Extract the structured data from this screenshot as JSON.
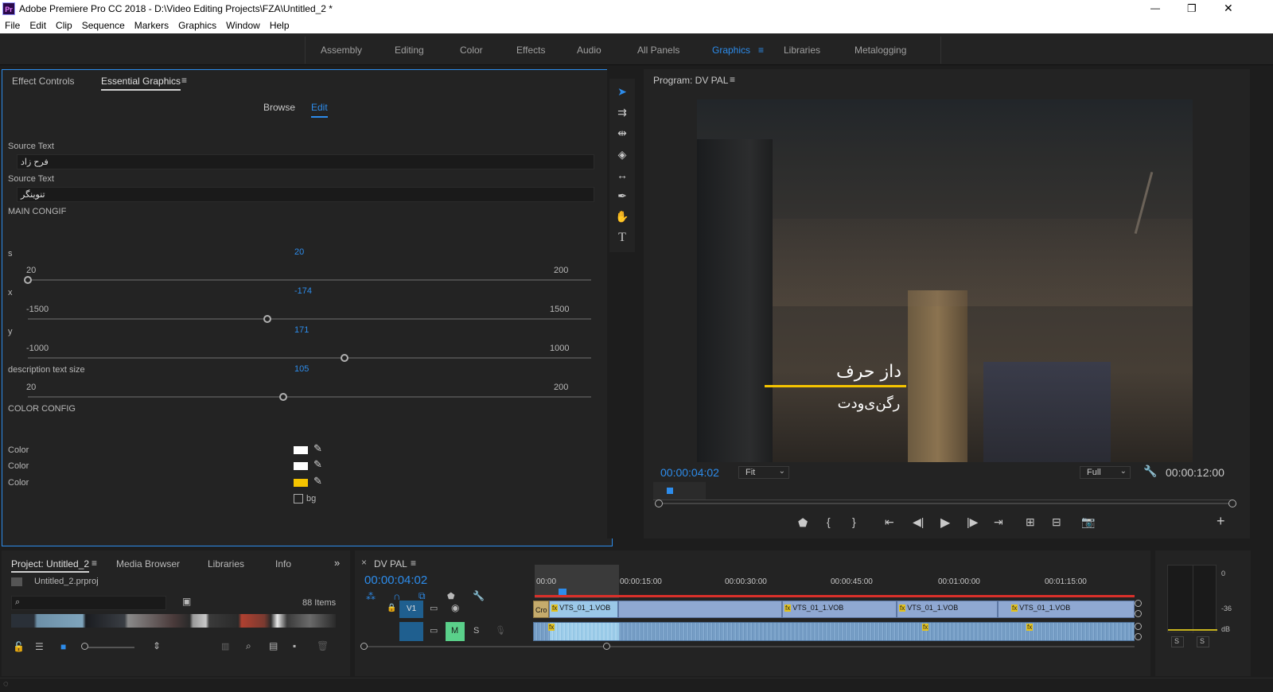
{
  "window": {
    "title": "Adobe Premiere Pro CC 2018 - D:\\Video Editing Projects\\FZA\\Untitled_2 *",
    "app_icon_text": "Pr",
    "minimize": "—",
    "maximize": "❐",
    "close": "✕"
  },
  "menu": [
    "File",
    "Edit",
    "Clip",
    "Sequence",
    "Markers",
    "Graphics",
    "Window",
    "Help"
  ],
  "workspaces": {
    "items": [
      "Assembly",
      "Editing",
      "Color",
      "Effects",
      "Audio",
      "All Panels",
      "Graphics",
      "Libraries",
      "Metalogging"
    ],
    "active": "Graphics",
    "menu_icon": "≡"
  },
  "essential_graphics": {
    "tabs": [
      "Effect Controls",
      "Essential Graphics"
    ],
    "active_tab": "Essential Graphics",
    "subtabs": [
      "Browse",
      "Edit"
    ],
    "active_subtab": "Edit",
    "source_text_label_1": "Source Text",
    "source_text_value_1": "فرح زاد",
    "source_text_label_2": "Source Text",
    "source_text_value_2": "تنوینگر",
    "main_config": "MAIN CONGIF",
    "color_config": "COLOR CONFIG",
    "sliders": [
      {
        "label": "s",
        "value": "20",
        "min": "20",
        "max": "200",
        "fraction": 0.0
      },
      {
        "label": "x",
        "value": "-174",
        "min": "-1500",
        "max": "1500",
        "fraction": 0.44
      },
      {
        "label": "y",
        "value": "171",
        "min": "-1000",
        "max": "1000",
        "fraction": 0.585
      },
      {
        "label": "description text size",
        "value": "105",
        "min": "20",
        "max": "200",
        "fraction": 0.47
      }
    ],
    "colors": [
      {
        "label": "Color",
        "swatch": "#ffffff"
      },
      {
        "label": "Color",
        "swatch": "#ffffff"
      },
      {
        "label": "Color",
        "swatch": "#f5c400"
      }
    ],
    "bg_checkbox_label": "bg",
    "eyedropper_icon": "eyedropper-icon"
  },
  "program_monitor": {
    "title": "Program: DV PAL",
    "overlay_title": "داز حرف",
    "overlay_subtitle": "رگن‌ی‌ودت",
    "accent_line_color": "#f5c400",
    "timecode": "00:00:04:02",
    "fit": "Fit",
    "quality": "Full",
    "duration": "00:00:12:00",
    "add_button": "+"
  },
  "project": {
    "tabs": [
      "Project: Untitled_2",
      "Media Browser",
      "Libraries",
      "Info"
    ],
    "active_tab": "Project: Untitled_2",
    "filename": "Untitled_2.prproj",
    "items_count": "88 Items",
    "more": "»"
  },
  "timeline": {
    "close": "×",
    "title": "DV PAL",
    "timecode": "00:00:04:02",
    "ruler": [
      "00:00",
      "00:00:15:00",
      "00:00:30:00",
      "00:00:45:00",
      "00:01:00:00",
      "00:01:15:00"
    ],
    "video_track": "V1",
    "audio_mute": "M",
    "audio_solo": "S",
    "clip_label": "VTS_01_1.VOB",
    "first_clip": "Cro",
    "fx": "fx"
  },
  "audio_meter": {
    "labels": [
      "0",
      "-36",
      "dB"
    ],
    "solo_buttons": [
      "S",
      "S"
    ]
  }
}
